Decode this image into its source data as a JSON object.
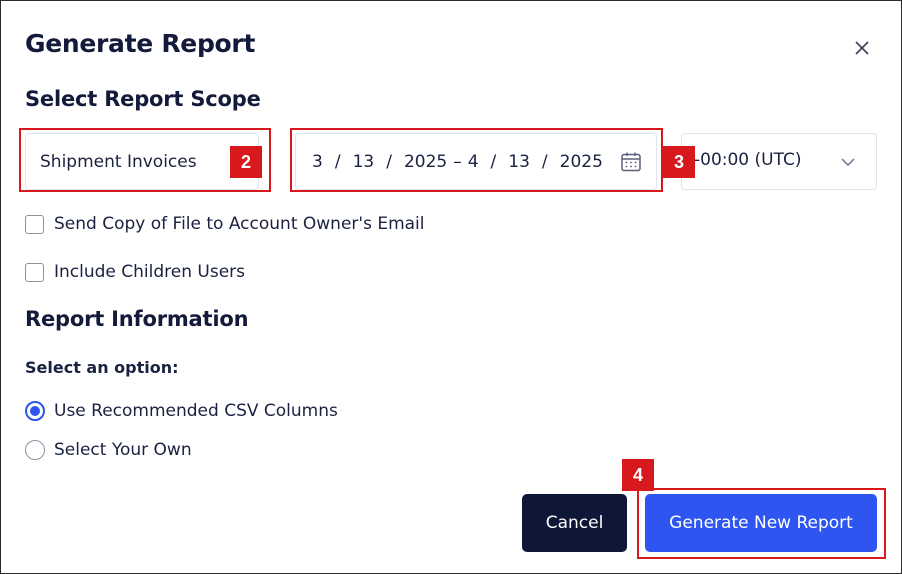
{
  "dialog": {
    "title": "Generate Report",
    "close_icon": "close-icon"
  },
  "scope": {
    "heading": "Select Report Scope",
    "report_type": "Shipment Invoices",
    "date_range": {
      "start_month": "3",
      "start_day": "13",
      "start_year": "2025",
      "separator": "–",
      "end_month": "4",
      "end_day": "13",
      "end_year": "2025",
      "slash": "/"
    },
    "calendar_icon": "calendar-icon",
    "timezone": "-00:00 (UTC)",
    "timezone_icon": "chevron-down-icon"
  },
  "options": {
    "send_copy_label": "Send Copy of File to Account Owner's Email",
    "send_copy_checked": false,
    "include_children_label": "Include Children Users",
    "include_children_checked": false
  },
  "info": {
    "heading": "Report Information",
    "prompt": "Select an option:",
    "choices": [
      {
        "label": "Use Recommended CSV Columns",
        "selected": true
      },
      {
        "label": "Select Your Own",
        "selected": false
      }
    ]
  },
  "actions": {
    "cancel_label": "Cancel",
    "generate_label": "Generate New Report"
  },
  "annotations": {
    "badge_2": "2",
    "badge_3": "3",
    "badge_4": "4",
    "color": "#d7191e"
  },
  "colors": {
    "primary": "#2e55f0",
    "dark": "#0f1739",
    "text": "#1b2140"
  }
}
